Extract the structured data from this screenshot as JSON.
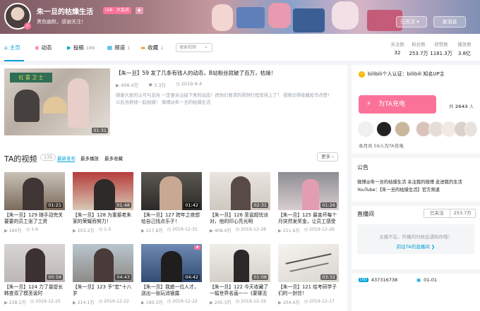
{
  "header": {
    "username": "朱一旦的枯燥生活",
    "badge_level": "LV6",
    "badge_vip": "大会员",
    "sign": "黑色幽默，感谢关注！",
    "follow_label": "已关注",
    "follow_caret": "▾",
    "message_label": "发消息"
  },
  "nav": {
    "items": [
      {
        "label": "主页",
        "count": ""
      },
      {
        "label": "动态",
        "count": ""
      },
      {
        "label": "投稿",
        "count": "189"
      },
      {
        "label": "频道",
        "count": "1"
      },
      {
        "label": "收藏",
        "count": "1"
      }
    ],
    "search_placeholder": "搜索视频"
  },
  "stats": [
    {
      "label": "关注数",
      "value": "32"
    },
    {
      "label": "粉丝数",
      "value": "253.7万"
    },
    {
      "label": "获赞数",
      "value": "1181.3万"
    },
    {
      "label": "播放数",
      "value": "3.8亿"
    }
  ],
  "featured": {
    "duration": "01:31",
    "title": "【朱一旦】59 发了几条有钱人的动态，B站粉丝就破了百万，枯燥！",
    "plays": "408.4万",
    "likes": "3.3万",
    "date": "2019-9-4",
    "desc": "感谢大家的认可与支持 一定要关注接下来的动态！把你们要求的视频行程安排上了！ 视频记得收藏投币点赞！以后也继续一起枯燥！ 微博@朱一旦的枯燥生活"
  },
  "videos_section": {
    "title": "TA的视频",
    "count": "135",
    "tabs": [
      "最新发布",
      "最多播放",
      "最多收藏"
    ],
    "more_label": "更多"
  },
  "videos": [
    {
      "title": "【朱一旦】129 随手动完关要要的员工张了工资",
      "duration": "01:21",
      "plays": "160万",
      "date": "1-6"
    },
    {
      "title": "【朱一旦】128 为重振老朱家的荣耀而努力！",
      "duration": "01:48",
      "plays": "203.2万",
      "date": "1-3"
    },
    {
      "title": "【朱一旦】127 跨年之夜想给自己找点乐子！",
      "duration": "01:42",
      "plays": "217.8万",
      "date": "2019-12-31"
    },
    {
      "title": "【朱一旦】126 圣诞超忧派对，他的印心亮光明",
      "duration": "02:31",
      "plays": "408.4万",
      "date": "2019-12-28"
    },
    {
      "title": "【朱一旦】125 最害坏每个月突然发奖金，让员工感受惊喜",
      "duration": "01:26",
      "plays": "211.6万",
      "date": "2019-12-26"
    },
    {
      "title": "【朱一旦】124 力了量提长韩查双了模圣诞时",
      "duration": "00:58",
      "plays": "238.1万",
      "date": "2019-12-25"
    },
    {
      "title": "【朱一旦】123 予“宏”十八岁",
      "duration": "04:43",
      "plays": "214.1万",
      "date": "2019-12-22"
    },
    {
      "title": "【朱一旦】我惑一位人才，送出一张玩消银露",
      "duration": "04:42",
      "plays": "190.3万",
      "date": "2019-12-22"
    },
    {
      "title": "【朱一旦】122 今天收藏了一幅世界名画——《蒙娜丑莎》",
      "duration": "01:08",
      "plays": "245.3万",
      "date": "2019-12-19"
    },
    {
      "title": "【朱一旦】121 给考研学子们的一封信！",
      "duration": "03:32",
      "plays": "204.4万",
      "date": "2019-12-17"
    }
  ],
  "right": {
    "auth": "bilibili个人认证：bilibili 知名UP主",
    "charge_label": "为TA充电",
    "charge_total_prefix": "共",
    "charge_total": "2643",
    "charge_total_suffix": "人",
    "charge_month": "本月共 59人为TA充电",
    "notice_title": "公告",
    "notice_text": "微博@朱一旦的枯燥生活 关注我的微博 走进我的生活 YouTube：【朱一旦的枯燥生活】官方频道",
    "live_title": "直播间",
    "live_follow": "已关注",
    "live_fans": "253.7万",
    "live_button": "为TA充电",
    "live_status": "主播不在，开播的时候会通知你哦！",
    "live_link": "前往TA的直播间 ❯",
    "uid_label": "UID",
    "uid": "437316738",
    "bday": "01-01"
  },
  "colors": {
    "accent": "#00a1d6",
    "pink": "#fb7299"
  }
}
